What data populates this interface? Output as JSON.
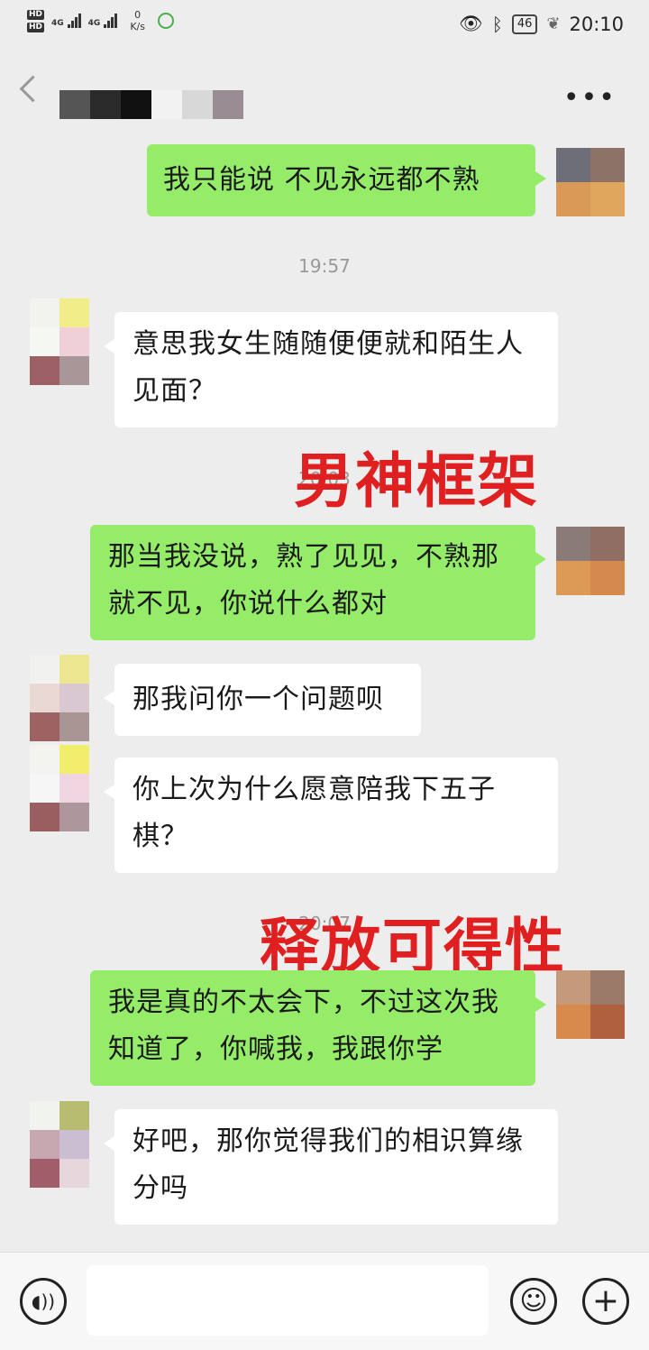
{
  "status_bar": {
    "sim1": "HD",
    "sim2": "HD",
    "net1": "4G",
    "net2": "4G",
    "speed_value": "0",
    "speed_unit": "K/s",
    "battery": "46",
    "time": "20:10"
  },
  "messages": [
    {
      "text": "我只能说  不见永远都不熟"
    },
    {
      "text": "意思我女生随随便便就和陌生人见面？"
    },
    {
      "text": "那当我没说，熟了见见，不熟那就不见，你说什么都对"
    },
    {
      "text": "那我问你一个问题呗"
    },
    {
      "text": "你上次为什么愿意陪我下五子棋？"
    },
    {
      "text": "我是真的不太会下，不过这次我知道了，你喊我，我跟你学"
    },
    {
      "text": "好吧，那你觉得我们的相识算缘分吗"
    }
  ],
  "timestamps": {
    "t1": "19:57",
    "t2": "20:03",
    "t3": "20:07"
  },
  "overlays": {
    "o1": "男神框架",
    "o2": "释放可得性"
  },
  "colors": {
    "outgoing": "#95ec69",
    "incoming": "#ffffff",
    "overlay": "#e02020",
    "background": "#ededed"
  },
  "icons": {
    "voice": "voice-icon",
    "emoji": "emoji-icon",
    "plus": "plus-icon",
    "back": "back-icon",
    "more": "more-icon"
  }
}
